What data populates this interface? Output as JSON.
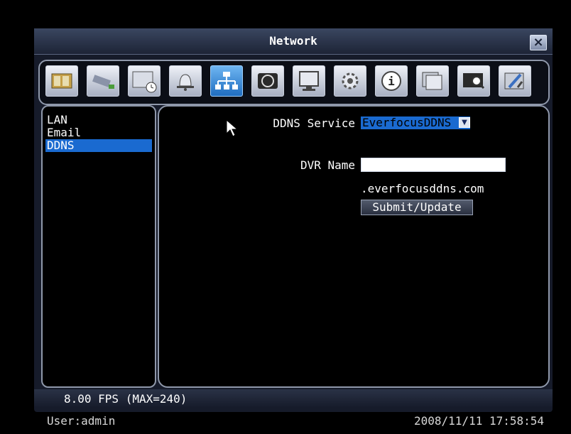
{
  "window": {
    "title": "Network",
    "close_glyph": "×"
  },
  "toolbar": {
    "icons": [
      {
        "name": "camera-film-icon"
      },
      {
        "name": "record-camera-icon"
      },
      {
        "name": "schedule-icon"
      },
      {
        "name": "alarm-bell-icon"
      },
      {
        "name": "network-icon",
        "active": true
      },
      {
        "name": "disk-icon"
      },
      {
        "name": "display-icon"
      },
      {
        "name": "system-gear-icon"
      },
      {
        "name": "info-icon"
      },
      {
        "name": "event-log-icon"
      },
      {
        "name": "search-icon"
      },
      {
        "name": "tools-icon"
      }
    ]
  },
  "menu": {
    "items": [
      {
        "label": "LAN"
      },
      {
        "label": "Email"
      },
      {
        "label": "DDNS",
        "selected": true
      }
    ]
  },
  "ddns": {
    "service_label": "DDNS Service",
    "service_value": "EverfocusDDNS",
    "dvr_name_label": "DVR Name",
    "dvr_name_value": "",
    "domain_suffix": ".everfocusddns.com",
    "submit_label": "Submit/Update"
  },
  "status": {
    "fps": "8.00 FPS (MAX=240)",
    "user": "User:admin",
    "datetime": "2008/11/11  17:58:54"
  },
  "colors": {
    "selection": "#1a6ad0",
    "panel_border": "#8f98aa",
    "window_bg": "#161b2a"
  }
}
